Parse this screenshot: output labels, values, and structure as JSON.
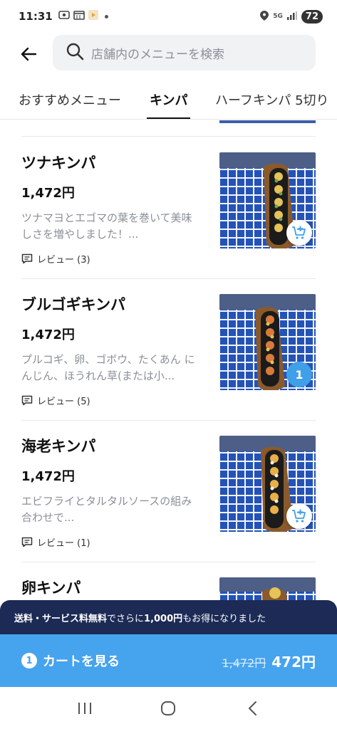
{
  "status_bar": {
    "time": "11:31",
    "network": "5G",
    "battery": "72"
  },
  "search": {
    "placeholder": "店舗内のメニューを検索"
  },
  "tabs": [
    {
      "label": "おすすめメニュー",
      "active": false
    },
    {
      "label": "キンパ",
      "active": true
    },
    {
      "label": "ハーフキンパ 5切り",
      "active": false
    }
  ],
  "items": [
    {
      "name": "ツナキンパ",
      "price": "1,472円",
      "desc": "ツナマヨとエゴマの葉を巻いて美味しさを増やしました！...",
      "review": "レビュー (3)",
      "cart_state": "add"
    },
    {
      "name": "ブルゴギキンパ",
      "price": "1,472円",
      "desc": "プルコギ、卵、ゴボウ、たくあん にんじん、ほうれん草(または小...",
      "review": "レビュー (5)",
      "cart_state": "quantity",
      "quantity": "1"
    },
    {
      "name": "海老キンパ",
      "price": "1,472円",
      "desc": "エビフライとタルタルソースの組み合わせで...",
      "review": "レビュー (1)",
      "cart_state": "add"
    },
    {
      "name": "卵キンパ"
    }
  ],
  "promo": {
    "part1": "送料・サービス料無料",
    "part2": "でさらに",
    "part3": "1,000円",
    "part4": "もお得になりました"
  },
  "cart": {
    "count": "1",
    "label": "カートを見る",
    "original_price": "1,472円",
    "total": "472円"
  },
  "colors": {
    "accent": "#46a3ee",
    "banner": "#1c2a55",
    "text_muted": "#8a8f98"
  }
}
